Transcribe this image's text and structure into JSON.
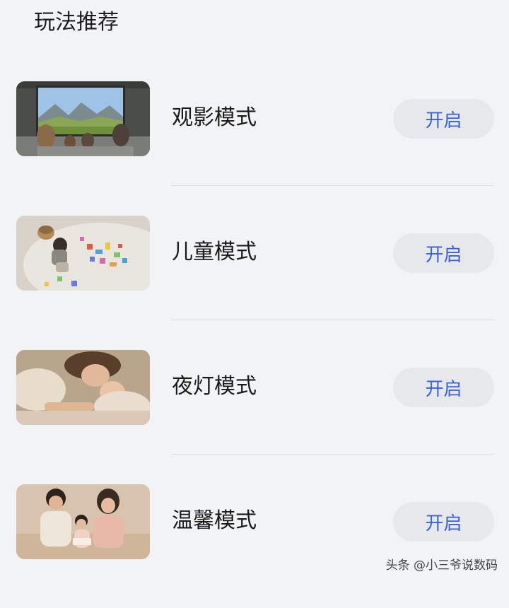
{
  "section": {
    "title": "玩法推荐"
  },
  "modes": [
    {
      "label": "观影模式",
      "button_label": "开启",
      "image": "family-watching-tv-image"
    },
    {
      "label": "儿童模式",
      "button_label": "开启",
      "image": "child-playing-blocks-image"
    },
    {
      "label": "夜灯模式",
      "button_label": "开启",
      "image": "mother-baby-sleeping-image"
    },
    {
      "label": "温馨模式",
      "button_label": "开启",
      "image": "family-reading-image"
    }
  ],
  "watermark": "头条 @小三爷说数码",
  "colors": {
    "background": "#f1f3f5",
    "button_bg": "#e6e8eb",
    "button_text": "#3b63d4",
    "divider": "#dadde1"
  }
}
